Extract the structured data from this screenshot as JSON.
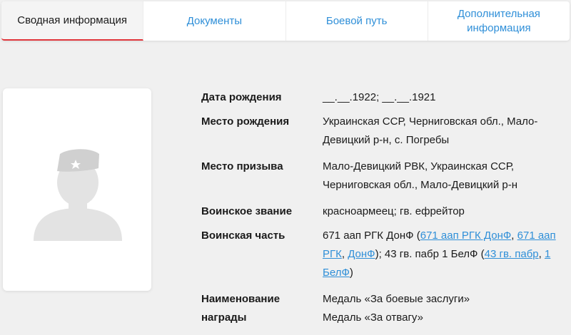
{
  "tabs": [
    {
      "label": "Сводная информация",
      "active": true
    },
    {
      "label": "Документы",
      "active": false
    },
    {
      "label": "Боевой путь",
      "active": false
    },
    {
      "label": "Дополнительная информация",
      "active": false
    }
  ],
  "photo": {
    "icon": "soldier-silhouette-icon"
  },
  "info": {
    "birth_date": {
      "label": "Дата рождения",
      "value": "__.__.1922; __.__.1921"
    },
    "birth_place": {
      "label": "Место рождения",
      "value": "Украинская ССР, Черниговская обл., Мало-Девицкий р-н, с. Погребы"
    },
    "draft_place": {
      "label": "Место призыва",
      "value": "Мало-Девицкий РВК, Украинская ССР, Черниговская обл., Мало-Девицкий р-н"
    },
    "rank": {
      "label": "Воинское звание",
      "value": "красноармеец; гв. ефрейтор"
    },
    "unit": {
      "label": "Воинская часть",
      "text1": "671 аап РГК ДонФ (",
      "link1": "671 аап РГК ДонФ",
      "sep1": ", ",
      "link2": "671 аап РГК",
      "sep2": ", ",
      "link3": "ДонФ",
      "text2": "); 43 гв. пабр 1 БелФ (",
      "link4": "43 гв. пабр",
      "sep3": ", ",
      "link5": "1 БелФ",
      "text3": ")"
    },
    "award": {
      "label": "Наименование награды",
      "values": [
        "Медаль «За боевые заслуги»",
        "Медаль «За отвагу»"
      ]
    }
  },
  "colors": {
    "accent": "#e0353b",
    "link": "#2f8fd8",
    "background": "#f0f0f0"
  }
}
